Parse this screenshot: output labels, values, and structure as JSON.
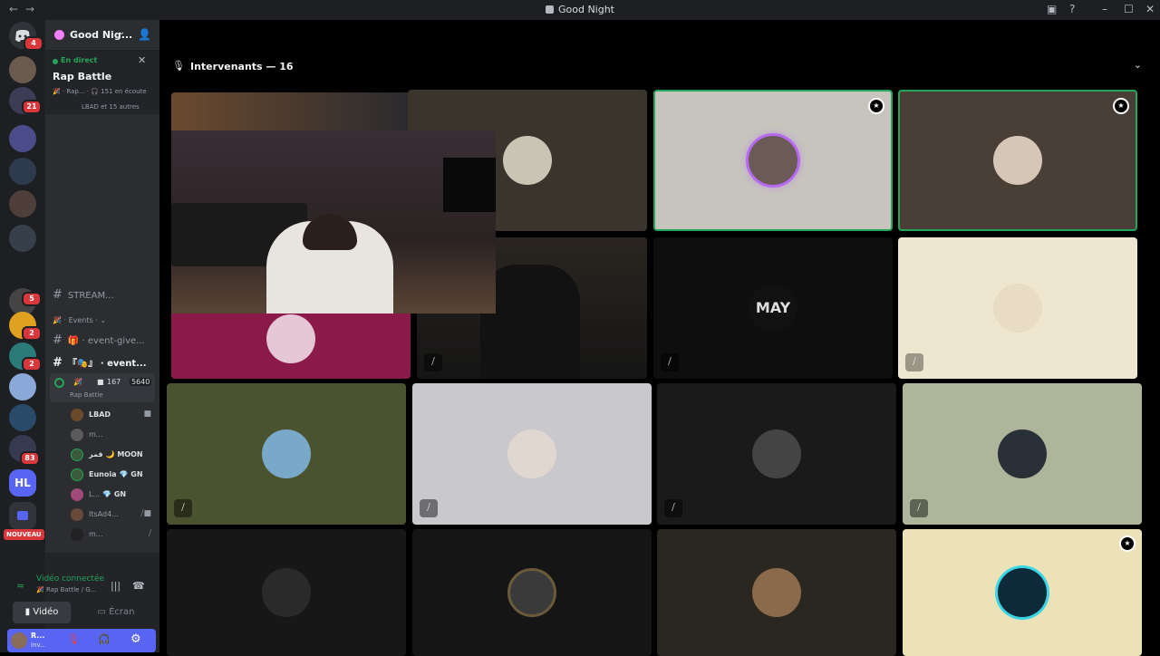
{
  "window": {
    "title": "Good Night",
    "nav": "←→"
  },
  "guild_bar": {
    "badges": {
      "dm": "4",
      "g2": "21",
      "g7": "5",
      "g8": "2",
      "g9": "2",
      "g12": "83"
    },
    "nouveau": "NOUVEAU"
  },
  "server": {
    "name": "Good Nig..."
  },
  "live_banner": {
    "status": "En direct",
    "title": "Rap Battle",
    "meta": "🎉 · Rap... · 🎧 151 en écoute",
    "more": "LBAD et 15 autres"
  },
  "channels": {
    "stream": "STREAM...",
    "events_cat": "🎉 · Events · ",
    "event_give": "🎁 · event-give...",
    "event": "『🎭』 · event..."
  },
  "voice": {
    "icons": "🎉",
    "cam_count": "167",
    "listeners": "5640",
    "name": "Rap Battle",
    "users": [
      {
        "name": "LBAD",
        "tag": "",
        "bold": true
      },
      {
        "name": "m...",
        "tag": "",
        "bold": false
      },
      {
        "name": "قمر",
        "tag": "🌙 MOON",
        "bold": true
      },
      {
        "name": "Eunoia",
        "tag": "💎 GN",
        "bold": true
      },
      {
        "name": "L...",
        "tag": "💎 GN",
        "bold": false
      },
      {
        "name": "ItsAd4...",
        "tag": "",
        "bold": false
      },
      {
        "name": "m...",
        "tag": "",
        "bold": false
      }
    ]
  },
  "panel": {
    "connected": "Vidéo connectée",
    "sub": "🎉 Rap Battle / G...",
    "video_btn": "Vidéo",
    "screen_btn": "Écran",
    "user_name": "R...",
    "user_status": "Inv..."
  },
  "main": {
    "speakers": "Intervenants — 16"
  },
  "colors": {
    "accent": "#5865f2",
    "speaking": "#23a55a",
    "danger": "#da373c"
  }
}
